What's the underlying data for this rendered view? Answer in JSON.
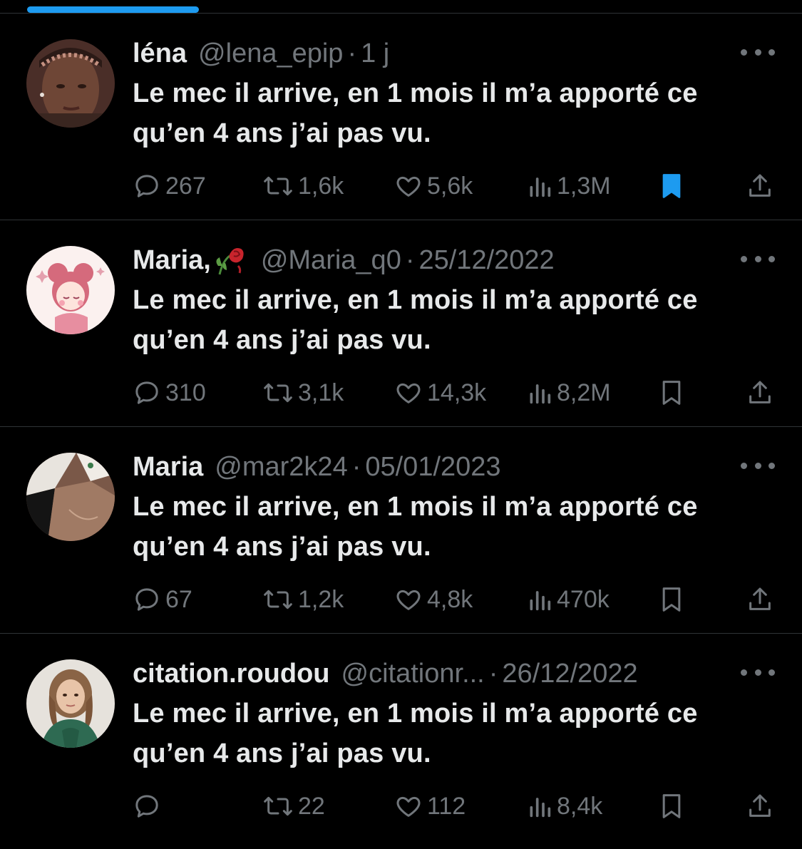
{
  "top_indicator_color": "#1d9bf0",
  "tweets": [
    {
      "display_name": "léna",
      "handle": "@lena_epip",
      "separator": "·",
      "date": "1 j",
      "text_line1": "Le mec il arrive, en 1 mois il m’a apporté ce",
      "text_line2": "qu’en 4 ans j’ai pas vu.",
      "replies": "267",
      "retweets": "1,6k",
      "likes": "5,6k",
      "views": "1,3M",
      "bookmarked": true
    },
    {
      "display_name": "Maria,",
      "name_emoji": "wilted-rose-emoji",
      "handle": "@Maria_q0",
      "separator": "·",
      "date": "25/12/2022",
      "text_line1": "Le mec il arrive, en 1 mois il m’a apporté ce",
      "text_line2": "qu’en 4 ans j’ai pas vu.",
      "replies": "310",
      "retweets": "3,1k",
      "likes": "14,3k",
      "views": "8,2M",
      "bookmarked": false
    },
    {
      "display_name": "Maria",
      "handle": "@mar2k24",
      "separator": "·",
      "date": "05/01/2023",
      "text_line1": "Le mec il arrive, en 1 mois il m’a apporté ce",
      "text_line2": "qu’en 4 ans j’ai pas vu.",
      "replies": "67",
      "retweets": "1,2k",
      "likes": "4,8k",
      "views": "470k",
      "bookmarked": false
    },
    {
      "display_name": "citation.roudou",
      "handle": "@citationr...",
      "separator": "·",
      "date": "26/12/2022",
      "text_line1": "Le mec il arrive, en 1 mois il m’a apporté ce",
      "text_line2": "qu’en 4 ans j’ai pas vu.",
      "replies": "",
      "retweets": "22",
      "likes": "112",
      "views": "8,4k",
      "bookmarked": false
    }
  ],
  "icons": {
    "reply": "reply-icon",
    "retweet": "retweet-icon",
    "like": "heart-icon",
    "views": "views-icon",
    "bookmark": "bookmark-icon",
    "share": "share-icon",
    "more": "more-icon"
  },
  "colors": {
    "background": "#000000",
    "text_primary": "#e7e9ea",
    "text_secondary": "#71767b",
    "divider": "#2f3336",
    "accent": "#1d9bf0"
  }
}
